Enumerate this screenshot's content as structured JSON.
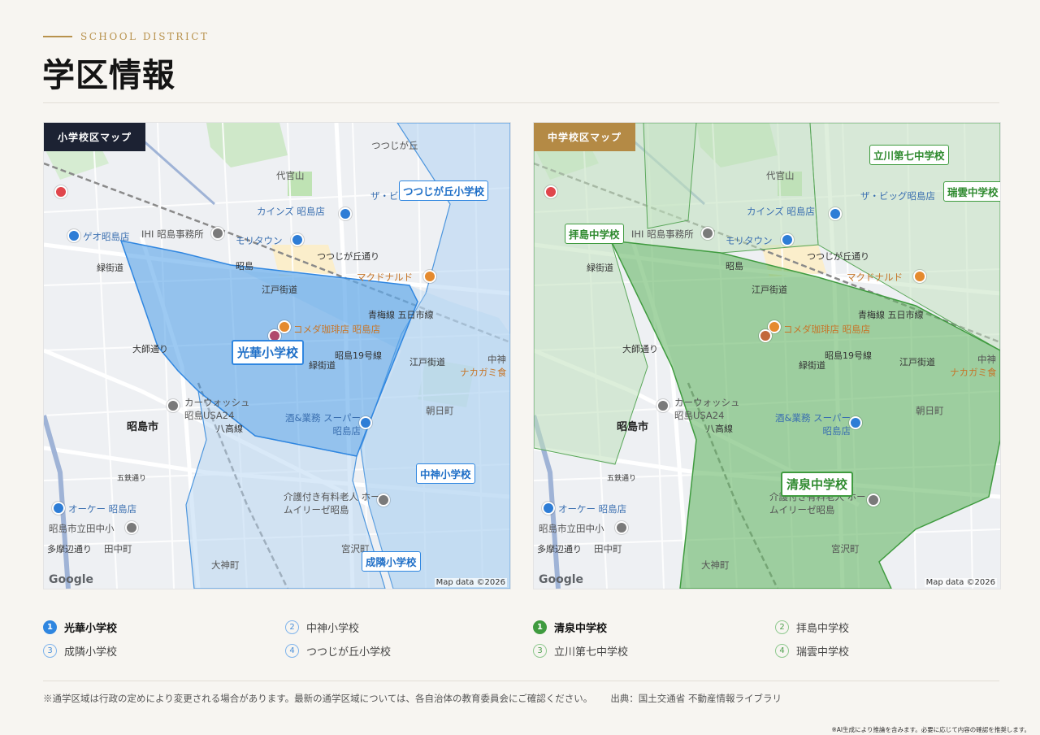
{
  "header": {
    "eyebrow": "SCHOOL DISTRICT",
    "title": "学区情報"
  },
  "colors": {
    "accent_gold": "#b8924d",
    "navy": "#1c2233",
    "elementary_blue": "#2f86e0",
    "junior_green": "#3f9b3f"
  },
  "maps": {
    "elementary": {
      "badge": "小学校区マップ",
      "district_labels": [
        "光華小学校",
        "つつじが丘小学校",
        "中神小学校",
        "成隣小学校"
      ],
      "attribution": "Map data ©2026"
    },
    "junior": {
      "badge": "中学校区マップ",
      "district_labels": [
        "清泉中学校",
        "立川第七中学校",
        "瑞雲中学校",
        "拝島中学校"
      ],
      "attribution": "Map data ©2026"
    },
    "base_labels": {
      "tsutsujigaoka": "つつじが丘",
      "daikanyama": "代官山",
      "the_big": "ザ・ビッグ昭島店",
      "cainz": "カインズ 昭島店",
      "ihi": "IHI 昭島事務所",
      "moritown": "モリタウン",
      "tsutsujigaoka_st": "つつじが丘通り",
      "geo": "ゲオ昭島店",
      "akishima_st": "昭島",
      "mcdonalds": "マクドナルド",
      "ryokkaido": "緑街道",
      "edokaido": "江戸街道",
      "komeda": "コメダ珈琲店 昭島店",
      "omeline": "青梅線 五日市線",
      "oshi_st": "大師通り",
      "showa19": "昭島19号線",
      "ryokkaido2": "緑街道",
      "edokaido2": "江戸街道",
      "nakagami": "中神",
      "nakagami_food": "ナカガミ食",
      "carwash": "カーウォッシュ 昭島USA24",
      "city": "昭島市",
      "gyomu": "酒&業務 スーパー 昭島店",
      "asahi": "朝日町",
      "hachiko": "八高線",
      "care": "介護付き有料老人 ホームイリーゼ昭島",
      "okay": "オーケー 昭島店",
      "tachida": "昭島市立田中小",
      "tanaka": "田中町",
      "miyazawa": "宮沢町",
      "ogami": "大神町",
      "tamabe": "多摩辺通り",
      "hachiko_line": "八高線",
      "five": "五鉄通り",
      "google": "Google"
    }
  },
  "legend": {
    "elementary": [
      {
        "num": "1",
        "name": "光華小学校",
        "primary": true
      },
      {
        "num": "2",
        "name": "中神小学校",
        "primary": false
      },
      {
        "num": "3",
        "name": "成隣小学校",
        "primary": false
      },
      {
        "num": "4",
        "name": "つつじが丘小学校",
        "primary": false
      }
    ],
    "junior": [
      {
        "num": "1",
        "name": "清泉中学校",
        "primary": true
      },
      {
        "num": "2",
        "name": "拝島中学校",
        "primary": false
      },
      {
        "num": "3",
        "name": "立川第七中学校",
        "primary": false
      },
      {
        "num": "4",
        "name": "瑞雲中学校",
        "primary": false
      }
    ]
  },
  "footer": {
    "note": "※通学区域は行政の定めにより変更される場合があります。最新の通学区域については、各自治体の教育委員会にご確認ください。",
    "source": "出典：国土交通省 不動産情報ライブラリ",
    "disclaimer": "※AI生成により推論を含みます。必要に応じて内容の確認を推奨します。"
  }
}
